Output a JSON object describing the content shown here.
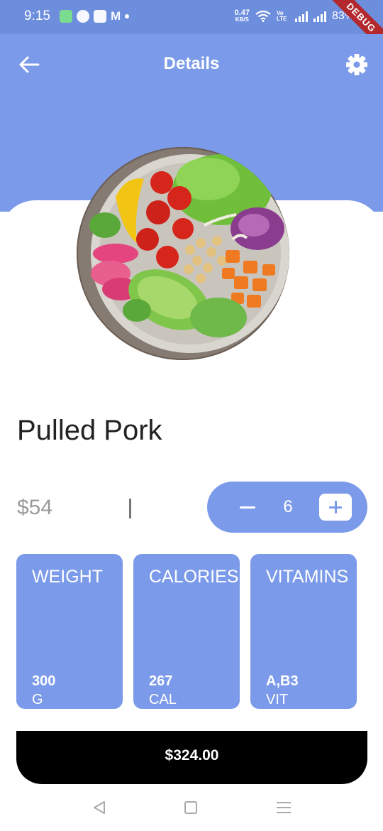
{
  "status_bar": {
    "time": "9:15",
    "net_speed_value": "0.47",
    "net_speed_unit": "KB/S",
    "volte": "Vo LTE",
    "battery": "83%"
  },
  "debug_banner": "DEBUG",
  "header": {
    "title": "Details",
    "back_icon": "arrow-left-icon",
    "settings_icon": "gear-icon"
  },
  "product": {
    "name": "Pulled Pork",
    "price": "$54",
    "quantity": "6",
    "image": "salad-bowl-photo"
  },
  "stats": [
    {
      "title": "WEIGHT",
      "value": "300",
      "unit": "G"
    },
    {
      "title": "CALORIES",
      "value": "267",
      "unit": "CAL"
    },
    {
      "title": "VITAMINS",
      "value": "A,B3",
      "unit": "VIT"
    }
  ],
  "total": "$324.00",
  "nav": {
    "back_icon": "triangle-back-icon",
    "home_icon": "square-home-icon",
    "menu_icon": "menu-icon"
  },
  "colors": {
    "accent": "#7b9ae9",
    "status_bar": "#6d8ddd",
    "button": "#000000"
  }
}
